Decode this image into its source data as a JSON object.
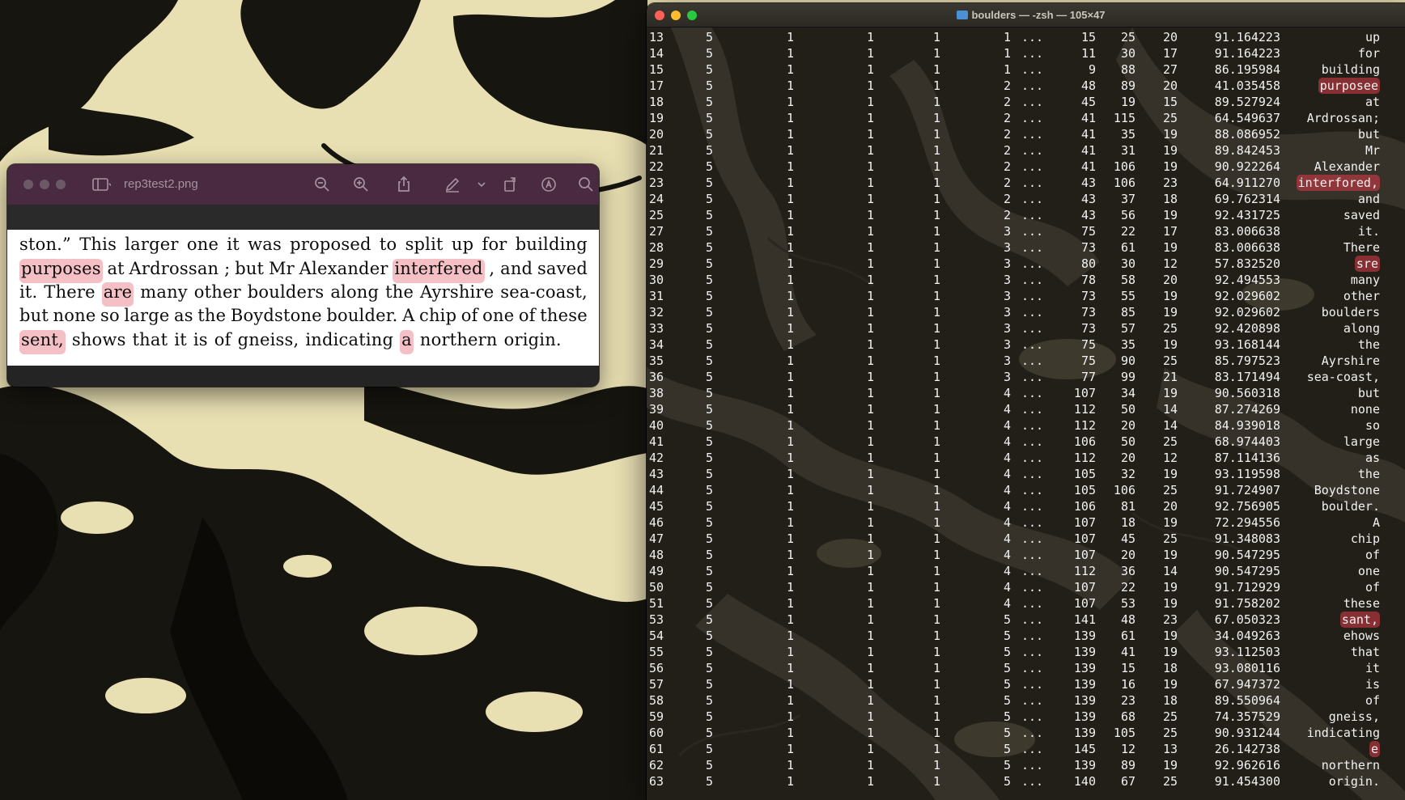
{
  "preview": {
    "filename": "rep3test2.png",
    "lines": [
      [
        {
          "t": "ston.”"
        },
        {
          "t": "This"
        },
        {
          "t": "larger"
        },
        {
          "t": "one"
        },
        {
          "t": "it"
        },
        {
          "t": "was"
        },
        {
          "t": "proposed"
        },
        {
          "t": "to"
        },
        {
          "t": "split"
        },
        {
          "t": "up"
        },
        {
          "t": "for"
        },
        {
          "t": "building"
        }
      ],
      [
        {
          "t": "purposes",
          "h": true
        },
        {
          "t": "at"
        },
        {
          "t": "Ardrossan ;"
        },
        {
          "t": "but"
        },
        {
          "t": "Mr"
        },
        {
          "t": "Alexander"
        },
        {
          "t": "interfered",
          "h": true
        },
        {
          "t": ", and"
        },
        {
          "t": "saved"
        }
      ],
      [
        {
          "t": "it."
        },
        {
          "t": "There"
        },
        {
          "t": "are",
          "h": true
        },
        {
          "t": "many"
        },
        {
          "t": "other"
        },
        {
          "t": "boulders"
        },
        {
          "t": "along"
        },
        {
          "t": "the"
        },
        {
          "t": "Ayrshire"
        },
        {
          "t": "sea-coast,"
        }
      ],
      [
        {
          "t": "but"
        },
        {
          "t": "none"
        },
        {
          "t": "so"
        },
        {
          "t": "large"
        },
        {
          "t": "as"
        },
        {
          "t": "the"
        },
        {
          "t": "Boydstone"
        },
        {
          "t": "boulder."
        },
        {
          "t": "A"
        },
        {
          "t": "chip"
        },
        {
          "t": "of"
        },
        {
          "t": "one"
        },
        {
          "t": "of"
        },
        {
          "t": "these"
        }
      ],
      [
        {
          "t": "sent,",
          "h": true
        },
        {
          "t": "shows"
        },
        {
          "t": "that"
        },
        {
          "t": "it"
        },
        {
          "t": "is"
        },
        {
          "t": "of"
        },
        {
          "t": "gneiss,"
        },
        {
          "t": "indicating"
        },
        {
          "t": "a",
          "h": true
        },
        {
          "t": "northern"
        },
        {
          "t": "origin."
        }
      ]
    ]
  },
  "terminal": {
    "title": "boulders — -zsh — 105×47",
    "ellipsis": "...",
    "rows": [
      [
        "13",
        "5",
        "1",
        "1",
        "1",
        "1",
        "15",
        "25",
        "20",
        "91.164223",
        "up",
        false
      ],
      [
        "14",
        "5",
        "1",
        "1",
        "1",
        "1",
        "11",
        "30",
        "17",
        "91.164223",
        "for",
        false
      ],
      [
        "15",
        "5",
        "1",
        "1",
        "1",
        "1",
        "9",
        "88",
        "27",
        "86.195984",
        "building",
        false
      ],
      [
        "17",
        "5",
        "1",
        "1",
        "1",
        "2",
        "48",
        "89",
        "20",
        "41.035458",
        "purposee",
        true
      ],
      [
        "18",
        "5",
        "1",
        "1",
        "1",
        "2",
        "45",
        "19",
        "15",
        "89.527924",
        "at",
        false
      ],
      [
        "19",
        "5",
        "1",
        "1",
        "1",
        "2",
        "41",
        "115",
        "25",
        "64.549637",
        "Ardrossan;",
        false
      ],
      [
        "20",
        "5",
        "1",
        "1",
        "1",
        "2",
        "41",
        "35",
        "19",
        "88.086952",
        "but",
        false
      ],
      [
        "21",
        "5",
        "1",
        "1",
        "1",
        "2",
        "41",
        "31",
        "19",
        "89.842453",
        "Mr",
        false
      ],
      [
        "22",
        "5",
        "1",
        "1",
        "1",
        "2",
        "41",
        "106",
        "19",
        "90.922264",
        "Alexander",
        false
      ],
      [
        "23",
        "5",
        "1",
        "1",
        "1",
        "2",
        "43",
        "106",
        "23",
        "64.911270",
        "interfored,",
        true
      ],
      [
        "24",
        "5",
        "1",
        "1",
        "1",
        "2",
        "43",
        "37",
        "18",
        "69.762314",
        "and",
        false
      ],
      [
        "25",
        "5",
        "1",
        "1",
        "1",
        "2",
        "43",
        "56",
        "19",
        "92.431725",
        "saved",
        false
      ],
      [
        "27",
        "5",
        "1",
        "1",
        "1",
        "3",
        "75",
        "22",
        "17",
        "83.006638",
        "it.",
        false
      ],
      [
        "28",
        "5",
        "1",
        "1",
        "1",
        "3",
        "73",
        "61",
        "19",
        "83.006638",
        "There",
        false
      ],
      [
        "29",
        "5",
        "1",
        "1",
        "1",
        "3",
        "80",
        "30",
        "12",
        "57.832520",
        "sre",
        true
      ],
      [
        "30",
        "5",
        "1",
        "1",
        "1",
        "3",
        "78",
        "58",
        "20",
        "92.494553",
        "many",
        false
      ],
      [
        "31",
        "5",
        "1",
        "1",
        "1",
        "3",
        "73",
        "55",
        "19",
        "92.029602",
        "other",
        false
      ],
      [
        "32",
        "5",
        "1",
        "1",
        "1",
        "3",
        "73",
        "85",
        "19",
        "92.029602",
        "boulders",
        false
      ],
      [
        "33",
        "5",
        "1",
        "1",
        "1",
        "3",
        "73",
        "57",
        "25",
        "92.420898",
        "along",
        false
      ],
      [
        "34",
        "5",
        "1",
        "1",
        "1",
        "3",
        "75",
        "35",
        "19",
        "93.168144",
        "the",
        false
      ],
      [
        "35",
        "5",
        "1",
        "1",
        "1",
        "3",
        "75",
        "90",
        "25",
        "85.797523",
        "Ayrshire",
        false
      ],
      [
        "36",
        "5",
        "1",
        "1",
        "1",
        "3",
        "77",
        "99",
        "21",
        "83.171494",
        "sea-coast,",
        false
      ],
      [
        "38",
        "5",
        "1",
        "1",
        "1",
        "4",
        "107",
        "34",
        "19",
        "90.560318",
        "but",
        false
      ],
      [
        "39",
        "5",
        "1",
        "1",
        "1",
        "4",
        "112",
        "50",
        "14",
        "87.274269",
        "none",
        false
      ],
      [
        "40",
        "5",
        "1",
        "1",
        "1",
        "4",
        "112",
        "20",
        "14",
        "84.939018",
        "so",
        false
      ],
      [
        "41",
        "5",
        "1",
        "1",
        "1",
        "4",
        "106",
        "50",
        "25",
        "68.974403",
        "large",
        false
      ],
      [
        "42",
        "5",
        "1",
        "1",
        "1",
        "4",
        "112",
        "20",
        "12",
        "87.114136",
        "as",
        false
      ],
      [
        "43",
        "5",
        "1",
        "1",
        "1",
        "4",
        "105",
        "32",
        "19",
        "93.119598",
        "the",
        false
      ],
      [
        "44",
        "5",
        "1",
        "1",
        "1",
        "4",
        "105",
        "106",
        "25",
        "91.724907",
        "Boydstone",
        false
      ],
      [
        "45",
        "5",
        "1",
        "1",
        "1",
        "4",
        "106",
        "81",
        "20",
        "92.756905",
        "boulder.",
        false
      ],
      [
        "46",
        "5",
        "1",
        "1",
        "1",
        "4",
        "107",
        "18",
        "19",
        "72.294556",
        "A",
        false
      ],
      [
        "47",
        "5",
        "1",
        "1",
        "1",
        "4",
        "107",
        "45",
        "25",
        "91.348083",
        "chip",
        false
      ],
      [
        "48",
        "5",
        "1",
        "1",
        "1",
        "4",
        "107",
        "20",
        "19",
        "90.547295",
        "of",
        false
      ],
      [
        "49",
        "5",
        "1",
        "1",
        "1",
        "4",
        "112",
        "36",
        "14",
        "90.547295",
        "one",
        false
      ],
      [
        "50",
        "5",
        "1",
        "1",
        "1",
        "4",
        "107",
        "22",
        "19",
        "91.712929",
        "of",
        false
      ],
      [
        "51",
        "5",
        "1",
        "1",
        "1",
        "4",
        "107",
        "53",
        "19",
        "91.758202",
        "these",
        false
      ],
      [
        "53",
        "5",
        "1",
        "1",
        "1",
        "5",
        "141",
        "48",
        "23",
        "67.050323",
        "sant,",
        true
      ],
      [
        "54",
        "5",
        "1",
        "1",
        "1",
        "5",
        "139",
        "61",
        "19",
        "34.049263",
        "ehows",
        false
      ],
      [
        "55",
        "5",
        "1",
        "1",
        "1",
        "5",
        "139",
        "41",
        "19",
        "93.112503",
        "that",
        false
      ],
      [
        "56",
        "5",
        "1",
        "1",
        "1",
        "5",
        "139",
        "15",
        "18",
        "93.080116",
        "it",
        false
      ],
      [
        "57",
        "5",
        "1",
        "1",
        "1",
        "5",
        "139",
        "16",
        "19",
        "67.947372",
        "is",
        false
      ],
      [
        "58",
        "5",
        "1",
        "1",
        "1",
        "5",
        "139",
        "23",
        "18",
        "89.550964",
        "of",
        false
      ],
      [
        "59",
        "5",
        "1",
        "1",
        "1",
        "5",
        "139",
        "68",
        "25",
        "74.357529",
        "gneiss,",
        false
      ],
      [
        "60",
        "5",
        "1",
        "1",
        "1",
        "5",
        "139",
        "105",
        "25",
        "90.931244",
        "indicating",
        false
      ],
      [
        "61",
        "5",
        "1",
        "1",
        "1",
        "5",
        "145",
        "12",
        "13",
        "26.142738",
        "e",
        true
      ],
      [
        "62",
        "5",
        "1",
        "1",
        "1",
        "5",
        "139",
        "89",
        "19",
        "92.962616",
        "northern",
        false
      ],
      [
        "63",
        "5",
        "1",
        "1",
        "1",
        "5",
        "140",
        "67",
        "25",
        "91.454300",
        "origin.",
        false
      ]
    ]
  }
}
